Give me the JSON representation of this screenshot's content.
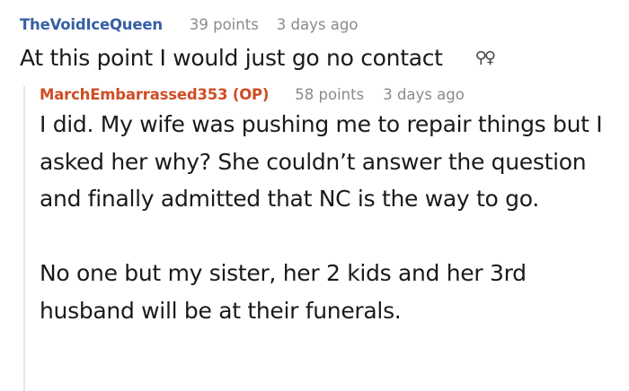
{
  "comments": [
    {
      "author": "TheVoidIceQueen",
      "points": "39 points",
      "time": "3 days ago",
      "text": "At this point I would just go no contact",
      "glyph": "⚲♀"
    },
    {
      "author": "MarchEmbarrassed353 (OP)",
      "points": "58 points",
      "time": "3 days ago",
      "paragraphs": [
        "I did. My wife was pushing me to repair things but I asked her why? She couldn’t answer the question and finally admitted that NC is the way to go.",
        "No one but my sister, her 2 kids and her 3rd husband will be at their funerals."
      ]
    }
  ],
  "colors": {
    "author_default": "#3560a3",
    "author_op": "#cf4d24",
    "meta_gray": "#8a8a8a",
    "thread_line": "#e6e6e6"
  }
}
